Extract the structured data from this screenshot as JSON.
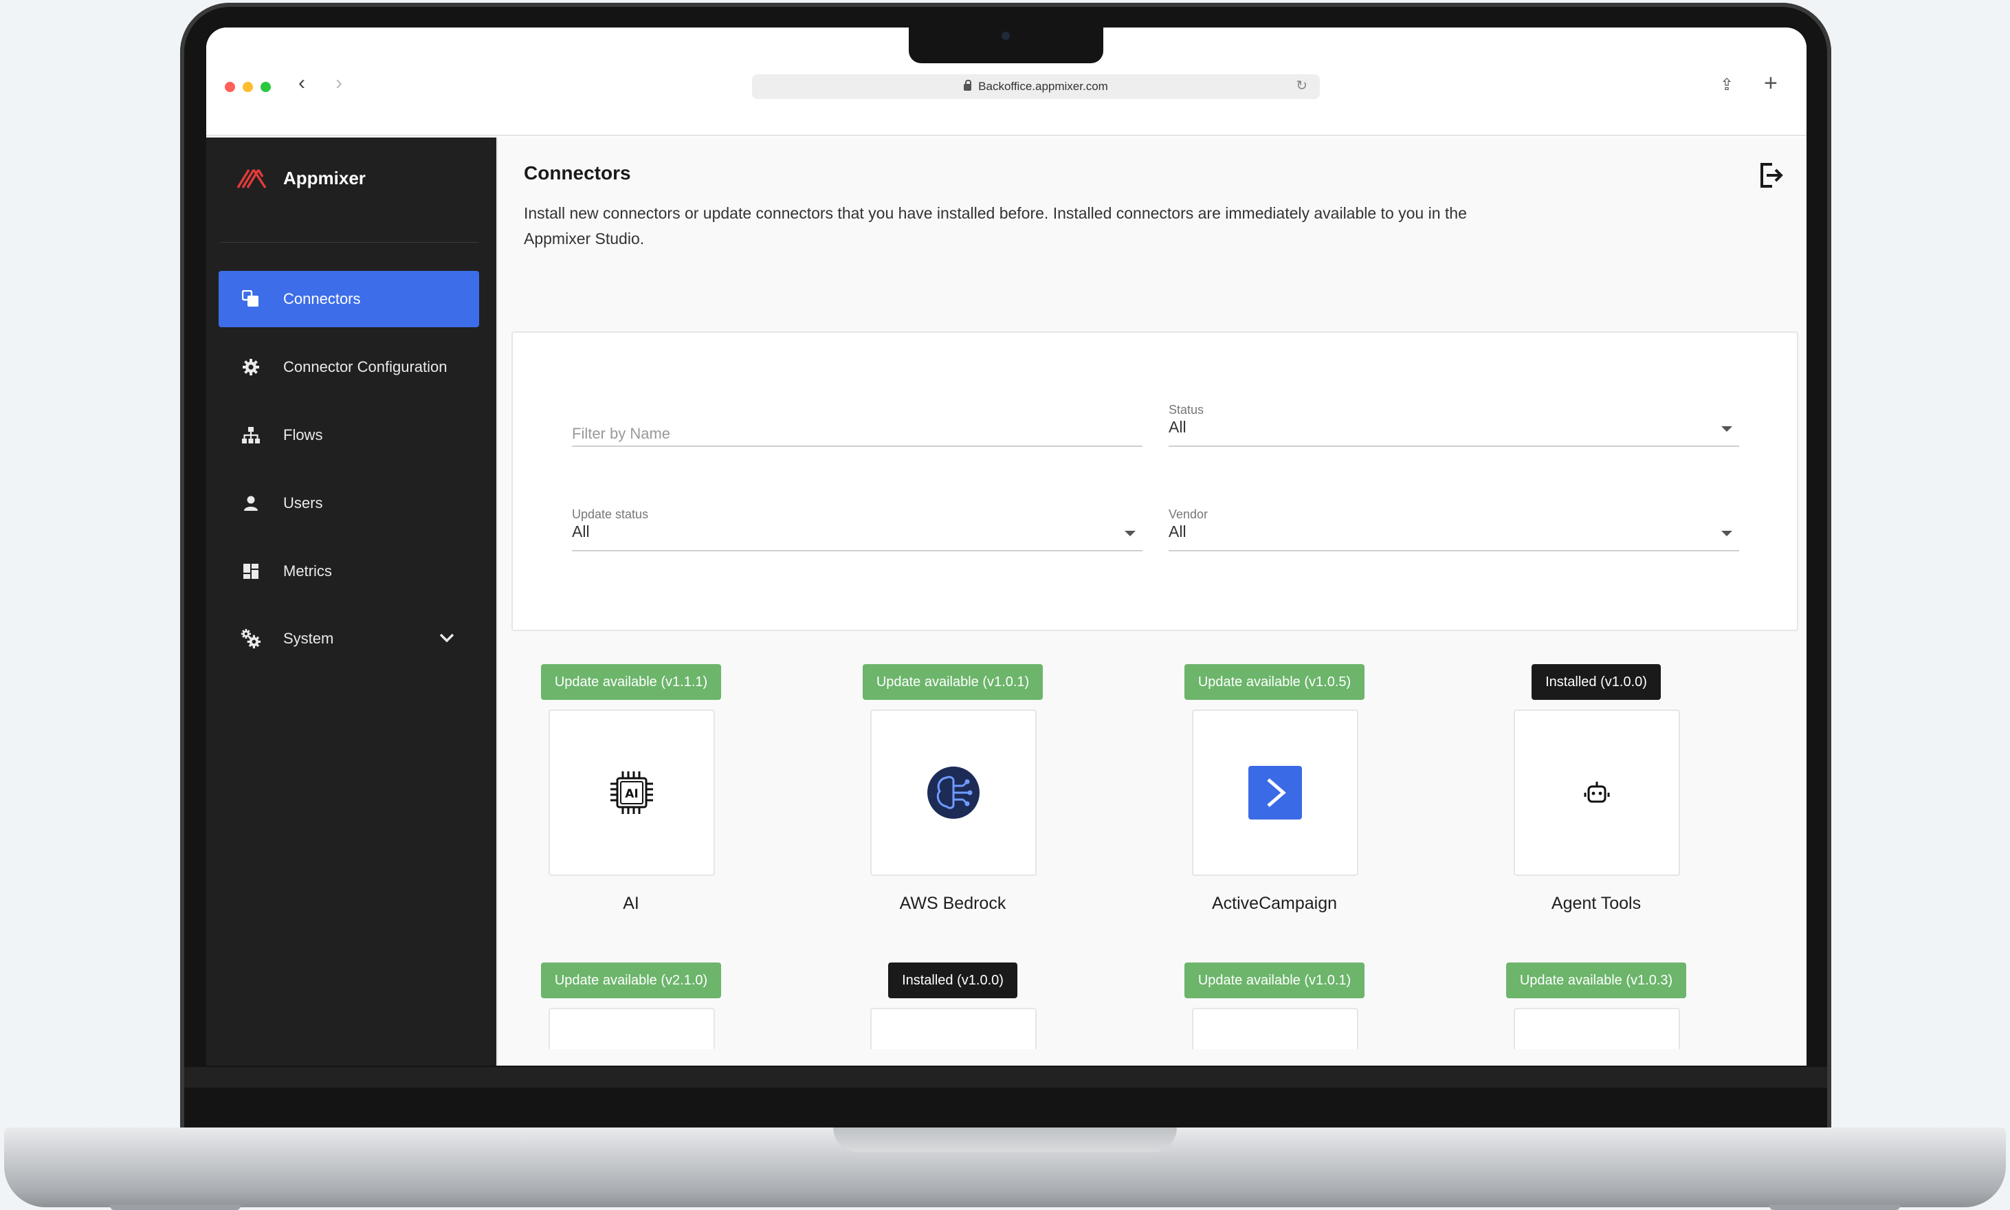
{
  "browser": {
    "url": "Backoffice.appmixer.com",
    "traffic_lights": [
      "#ff5f57",
      "#febc2e",
      "#28c840"
    ]
  },
  "sidebar": {
    "brand": "Appmixer",
    "items": [
      {
        "label": "Connectors",
        "icon": "connectors-icon",
        "active": true
      },
      {
        "label": "Connector Configuration",
        "icon": "gear-icon",
        "active": false
      },
      {
        "label": "Flows",
        "icon": "sitemap-icon",
        "active": false
      },
      {
        "label": "Users",
        "icon": "user-icon",
        "active": false
      },
      {
        "label": "Metrics",
        "icon": "dashboard-icon",
        "active": false
      },
      {
        "label": "System",
        "icon": "cogs-icon",
        "active": false,
        "expandable": true
      }
    ]
  },
  "main": {
    "title": "Connectors",
    "description": "Install new connectors or update connectors that you have installed before. Installed connectors are immediately available to you in the Appmixer Studio."
  },
  "filters": {
    "name_placeholder": "Filter by Name",
    "status": {
      "label": "Status",
      "value": "All"
    },
    "update_status": {
      "label": "Update status",
      "value": "All"
    },
    "vendor": {
      "label": "Vendor",
      "value": "All"
    }
  },
  "connectors": [
    {
      "name": "AI",
      "badge": "Update available (v1.1.1)",
      "badge_type": "update",
      "icon": "ai-chip-icon"
    },
    {
      "name": "AWS Bedrock",
      "badge": "Update available (v1.0.1)",
      "badge_type": "update",
      "icon": "aws-bedrock-icon"
    },
    {
      "name": "ActiveCampaign",
      "badge": "Update available (v1.0.5)",
      "badge_type": "update",
      "icon": "activecampaign-icon"
    },
    {
      "name": "Agent Tools",
      "badge": "Installed (v1.0.0)",
      "badge_type": "installed",
      "icon": "robot-icon"
    },
    {
      "name": "",
      "badge": "Update available (v2.1.0)",
      "badge_type": "update"
    },
    {
      "name": "",
      "badge": "Installed (v1.0.0)",
      "badge_type": "installed"
    },
    {
      "name": "",
      "badge": "Update available (v1.0.1)",
      "badge_type": "update"
    },
    {
      "name": "",
      "badge": "Update available (v1.0.3)",
      "badge_type": "update"
    }
  ],
  "colors": {
    "accent": "#3d6de8",
    "sidebar_bg": "#202020",
    "update_badge": "#6cb56b",
    "installed_badge": "#1a1a1a"
  }
}
